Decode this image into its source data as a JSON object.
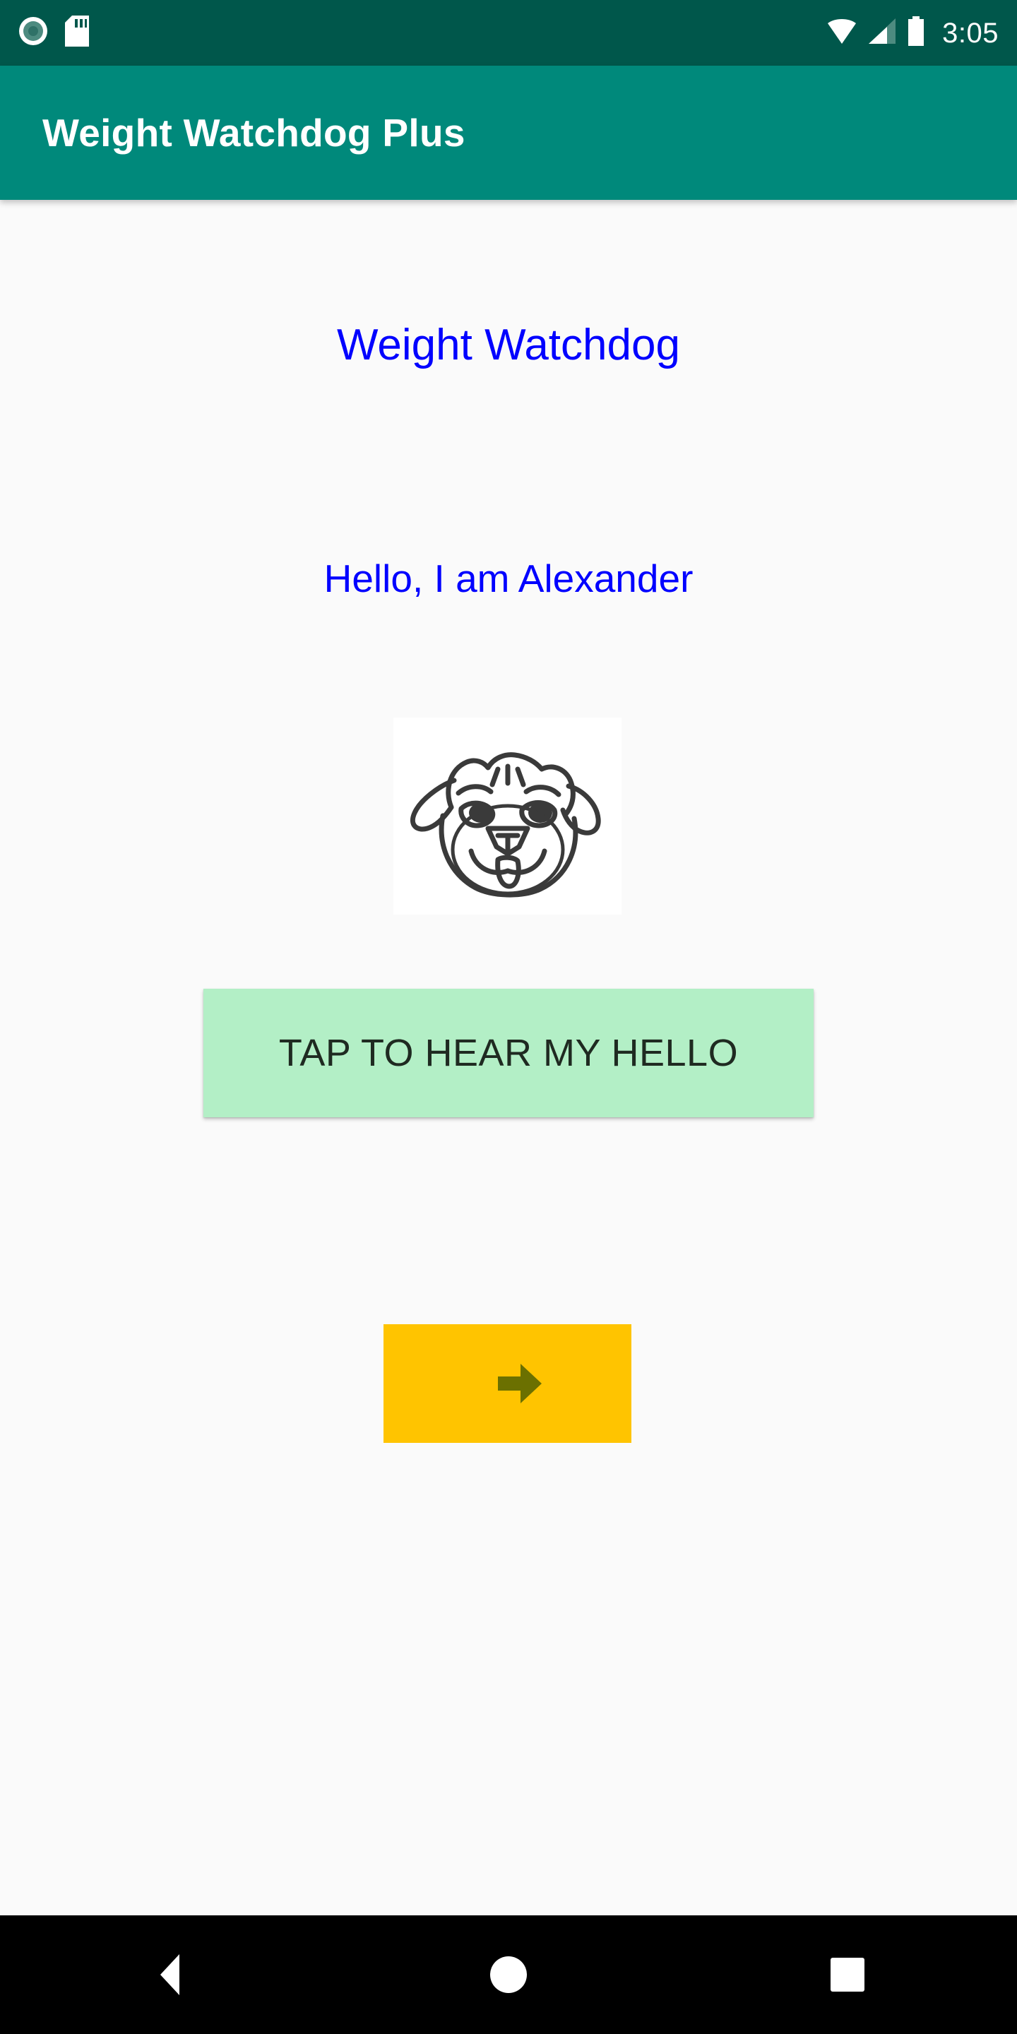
{
  "status_bar": {
    "icons_left": [
      "screen-record-icon",
      "sd-card-icon"
    ],
    "icons_right": [
      "wifi-icon",
      "cellular-signal-icon",
      "battery-icon"
    ],
    "time": "3:05",
    "background_color": "#00574B"
  },
  "app_bar": {
    "title": "Weight Watchdog Plus",
    "background_color": "#00897B",
    "title_color": "#FFFFFF"
  },
  "content": {
    "background_color": "#FAFAFA",
    "heading_main": "Weight Watchdog",
    "heading_main_color": "#0000FF",
    "heading_sub": "Hello, I am Alexander",
    "heading_sub_color": "#0000FF",
    "dog_image": {
      "name": "dog-face-drawing",
      "background_color": "#FFFFFF",
      "stroke_color": "#3A3A3A"
    },
    "hello_button": {
      "label": "TAP TO HEAR MY HELLO",
      "background_color": "#B3EFC6",
      "text_color": "#1F2A21"
    },
    "next_button": {
      "icon": "arrow-right-icon",
      "background_color": "#FFC400",
      "icon_color": "#6B7000"
    }
  },
  "nav_bar": {
    "background_color": "#000000",
    "buttons": [
      {
        "name": "back",
        "icon": "triangle-left-icon"
      },
      {
        "name": "home",
        "icon": "circle-icon"
      },
      {
        "name": "recents",
        "icon": "square-icon"
      }
    ]
  }
}
